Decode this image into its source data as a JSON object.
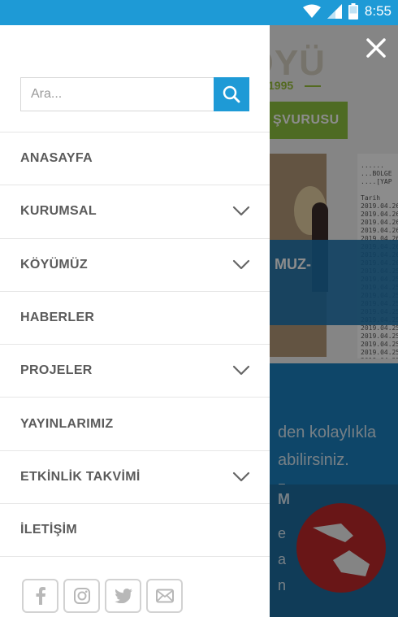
{
  "status_bar": {
    "time": "8:55",
    "icons": [
      "wifi-icon",
      "signal-icon",
      "battery-icon"
    ]
  },
  "background": {
    "logo_text": "YENİCEKÖYÜ",
    "logo_year": "1995",
    "green_button_label": "ŞVURUSU",
    "banner_text": "MUZ-",
    "table_text": "......\n...BOLGE\n....[YAP\n\nTarih\n2019.04.26\n2019.04.26\n2019.04.26\n2019.04.26\n2019.04.26\n2019.04.26\n2019.04.26\n2019.04.26\n2019.04.25\n2019.04.25\n2019.04.25\n2019.04.25\n2019.04.25\n2019.04.25\n2019.04.25\n2019.04.25\n2019.04.25\n2019.04.25\n2019.04.25\n2019.04.25",
    "blue_line_1": "den kolaylıkla",
    "blue_line_2": "abilirsiniz.",
    "blue_line_3": "z.",
    "dark_title": "M",
    "dark_line_1": "e",
    "dark_line_2": "a",
    "dark_line_3": "n",
    "colors": {
      "accent": "#1e9ad6",
      "green": "#8fc341",
      "dark_blue": "#1e6da0",
      "red": "#c0282a"
    }
  },
  "drawer": {
    "search": {
      "placeholder": "Ara...",
      "value": ""
    },
    "menu": [
      {
        "label": "ANASAYFA",
        "has_submenu": false
      },
      {
        "label": "KURUMSAL",
        "has_submenu": true
      },
      {
        "label": "KÖYÜMÜZ",
        "has_submenu": true
      },
      {
        "label": "HABERLER",
        "has_submenu": false
      },
      {
        "label": "PROJELER",
        "has_submenu": true
      },
      {
        "label": "YAYINLARIMIZ",
        "has_submenu": false
      },
      {
        "label": "ETKİNLİK TAKVİMİ",
        "has_submenu": true
      },
      {
        "label": "İLETİŞİM",
        "has_submenu": false
      }
    ],
    "social": [
      "facebook-icon",
      "instagram-icon",
      "twitter-icon",
      "mail-icon"
    ]
  }
}
